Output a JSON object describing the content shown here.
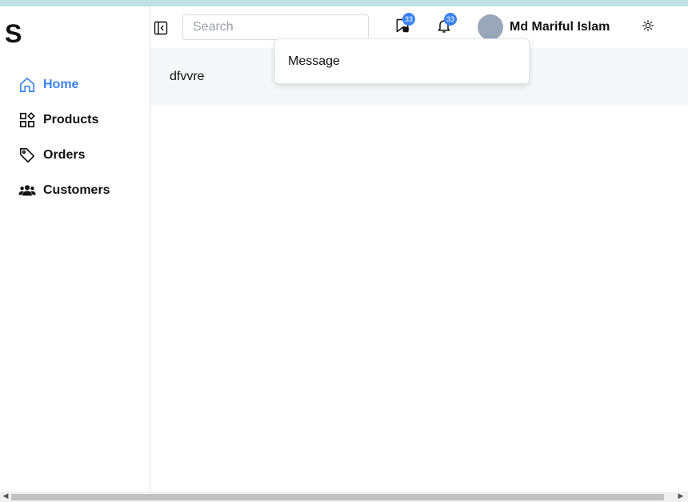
{
  "app": {
    "logo_text": "S"
  },
  "sidebar": {
    "items": [
      {
        "label": "Home",
        "icon": "home-icon",
        "active": true
      },
      {
        "label": "Products",
        "icon": "grid-shapes-icon",
        "active": false
      },
      {
        "label": "Orders",
        "icon": "tag-icon",
        "active": false
      },
      {
        "label": "Customers",
        "icon": "users-icon",
        "active": false
      }
    ]
  },
  "header": {
    "search_placeholder": "Search",
    "messages_badge": "33",
    "notifications_badge": "33",
    "user_name": "Md Mariful Islam",
    "theme_icon": "sun-icon"
  },
  "dropdown": {
    "items": [
      {
        "label": "Message"
      }
    ]
  },
  "content": {
    "text": "dfvvre"
  },
  "colors": {
    "accent": "#3b82f6",
    "top_strip": "#bfe0e4",
    "avatar": "#9aa7b8"
  }
}
